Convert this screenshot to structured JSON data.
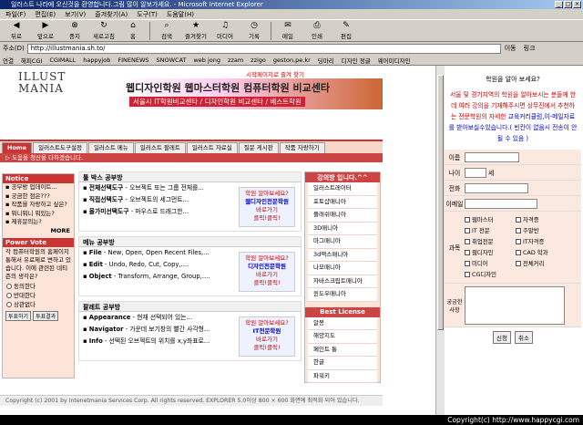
{
  "window": {
    "title": "일러스트 나라에 오신것을 환영합니다.그림 많이 알보가세요. - Microsoft Internet Explorer"
  },
  "menu": [
    "파일(F)",
    "편집(E)",
    "보기(V)",
    "즐겨찾기(A)",
    "도구(T)",
    "도움말(H)"
  ],
  "toolbar": [
    {
      "label": "뒤로",
      "icon": "back-icon"
    },
    {
      "label": "앞으로",
      "icon": "forward-icon"
    },
    {
      "label": "중지",
      "icon": "stop-icon"
    },
    {
      "label": "새로고침",
      "icon": "refresh-icon"
    },
    {
      "label": "홈",
      "icon": "home-icon"
    },
    {
      "label": "검색",
      "icon": "search-icon"
    },
    {
      "label": "즐겨찾기",
      "icon": "favorites-icon"
    },
    {
      "label": "미디어",
      "icon": "media-icon"
    },
    {
      "label": "기록",
      "icon": "history-icon"
    },
    {
      "label": "메일",
      "icon": "mail-icon"
    },
    {
      "label": "인쇄",
      "icon": "print-icon"
    },
    {
      "label": "편집",
      "icon": "edit-icon"
    }
  ],
  "address": {
    "label": "주소(D)",
    "url": "http://illustmania.sh.to/",
    "go": "이동",
    "links": "링크"
  },
  "links": [
    "연결",
    "해피CGI",
    "CGIMALL",
    "happyjob",
    "FINENEWS",
    "SNOWCAT",
    "web jong",
    "zzam",
    "zzigo",
    "geston,pe.kr",
    "딩마리",
    "디자인 정글",
    "웨어미디자인"
  ],
  "site": {
    "logo": "ILLUST MANIA",
    "toplinks": "시작페이지로    즐겨 찾기",
    "banner_main": "웹디자인학원 웹마스터학원 컴퓨터학원 비교센타",
    "banner_sub": "서울시 IT학원비교센타 / 디자인학원 비교센타 / 베스트학원"
  },
  "nav": [
    "Home",
    "일러스트도구설정",
    "일러스트 메뉴",
    "일러스트 팔레트",
    "일러스트 자료실",
    "질문 게시판",
    "작품 자랑하기"
  ],
  "subnav": "▷ 도움을 청산을 다하겠습니다.",
  "notice": {
    "title": "Notice",
    "items": [
      "공부방 업데이트...",
      "궁금한 점은???",
      "작품을 자랑하고 싶은?",
      "뭐니뭐니 뭐있는?",
      "제휴문의는?"
    ],
    "more": "MORE"
  },
  "vote": {
    "title": "Power Vote",
    "question": "각 컴퓨터학원의 홈페이지 통해서 유료제로 변하고 있습니다. 이에 관련된 네티즌의 생각은?",
    "options": [
      "동의한다",
      "반대한다",
      "상관없다"
    ],
    "vote_btn": "투표하기",
    "result_btn": "투표결과"
  },
  "sections": [
    {
      "title": "툴 박스 공부방",
      "items": [
        [
          "전체선택도구",
          "- 오브젝트 또는 그룹 전체를..."
        ],
        [
          "직접선택도구",
          "- 오브젝트의 세그먼트..."
        ],
        [
          "올가미선택도구",
          "- 마우스로 드래그한..."
        ]
      ],
      "ad": [
        "학원 알아보세요?",
        "웹디자인전문학원",
        "바로가기",
        "클릭!클릭!"
      ]
    },
    {
      "title": "메뉴 공부방",
      "items": [
        [
          "File",
          "- New, Open, Open Recent Files,..."
        ],
        [
          "Edit",
          "- Undo, Redo, Cut, Copy,...."
        ],
        [
          "Object",
          "- Transform, Arrange, Group,...."
        ]
      ],
      "ad": [
        "학원 알아보세요?",
        "디자인전문학원",
        "바로가기",
        "클릭!클릭!"
      ]
    },
    {
      "title": "팔레트 공부방",
      "items": [
        [
          "Appearance",
          "- 현재 선택되어 있는..."
        ],
        [
          "Navigator",
          "- 가운데 보기창의 빨간 사각형..."
        ],
        [
          "Info",
          "- 선택된 오브젝트의 위치를 x,y좌표로..."
        ]
      ],
      "ad": [
        "학원 알아보세요?",
        "IT전문학원",
        "바로가기",
        "클릭!클릭!"
      ]
    }
  ],
  "right": {
    "title": "강의방 입니다.^^",
    "items": [
      "일러스트레이터",
      "포토샵매니아",
      "플래쉬매니아",
      "3D매니아",
      "마그매니아",
      "3d맥스매니아",
      "나모매니아",
      "자바스크립트매니아",
      "윈도우매니아"
    ],
    "best_title": "Best License",
    "best": [
      "알몽",
      "해양지도",
      "페인트 통",
      "한글",
      "파워키"
    ]
  },
  "footer": "Copyright (c) 2001 by Intenetmania Services Corp. All rights reserved, EXPLORER 5.0이상 800 × 600 화면에 최적화 되어 있습니다.",
  "form": {
    "title": "학원을 알아 보세요?",
    "desc1": "서울 및 경기지역의 학원을 알아보시는 분들께 한데 여러 강의을 기재해주시면 상무진에서 추천하는 전문학원의 자세한",
    "desc2": "교육커리큘럼,이-메일자료를 받아보실수있습니다.( 빈칸이 없음시 전송이 안될 수 있음 )",
    "name": "이름",
    "age": "나이",
    "age_unit": "세",
    "phone": "전화",
    "email": "이메일",
    "course": "과목",
    "msg": "궁금한 사항",
    "courses": [
      "웹마스터",
      "자격증",
      "IT 전문",
      "주말반",
      "취업전문",
      "IT자격증",
      "웹디자인",
      "CAD 학과",
      "미디어",
      "전체커리",
      "CG디자인"
    ],
    "submit": "신청",
    "cancel": "취소"
  },
  "status": "Copyright(c) http://www.happycgi.com"
}
